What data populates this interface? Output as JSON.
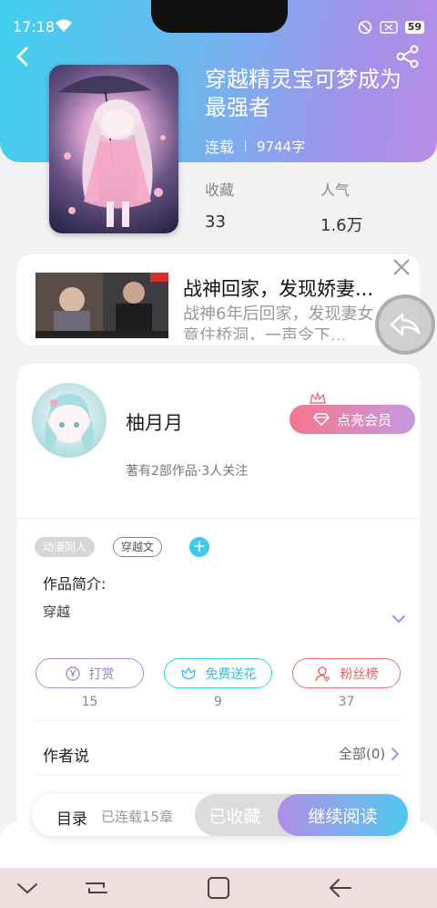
{
  "status_bar": {
    "time": "17:18",
    "battery": "59"
  },
  "book": {
    "title": "穿越精灵宝可梦成为最强者",
    "status": "连载",
    "word_count": "9744字",
    "stats": [
      {
        "label": "收藏",
        "value": "33"
      },
      {
        "label": "人气",
        "value": "1.6万"
      }
    ]
  },
  "ad": {
    "title": "战神回家，发现娇妻...",
    "description": "战神6年后回家，发现妻女竟住桥洞，一声令下..."
  },
  "author": {
    "name": "柚月月",
    "vip_button": "点亮会员",
    "stats": "著有2部作品·3人关注"
  },
  "tags": [
    "动漫同人",
    "穿越文"
  ],
  "intro": {
    "label": "作品简介:",
    "text": "穿越"
  },
  "actions": [
    {
      "label": "打赏",
      "count": "15"
    },
    {
      "label": "免费送花",
      "count": "9"
    },
    {
      "label": "粉丝榜",
      "count": "37"
    }
  ],
  "author_says": {
    "label": "作者说",
    "all": "全部(0)"
  },
  "bottom": {
    "toc": "目录",
    "progress": "已连载15章",
    "collected": "已收藏",
    "continue": "继续阅读"
  },
  "colors": {
    "header_gradient_start": "#3fd0ee",
    "header_gradient_end": "#b88ee6",
    "tip_purple": "#9a7ad8",
    "flower_cyan": "#2fbfe6",
    "fans_red": "#e85c5c"
  },
  "icons": {
    "back": "back-arrow-icon",
    "share": "share-icon",
    "close": "close-icon",
    "floating_back": "reply-arrow-icon",
    "crown": "crown-icon",
    "diamond": "diamond-icon",
    "add": "plus-icon",
    "expand": "chevron-down-icon",
    "tip": "yen-coin-icon",
    "flower": "flower-icon",
    "fans": "user-heart-icon",
    "chevron": "chevron-right-icon"
  }
}
